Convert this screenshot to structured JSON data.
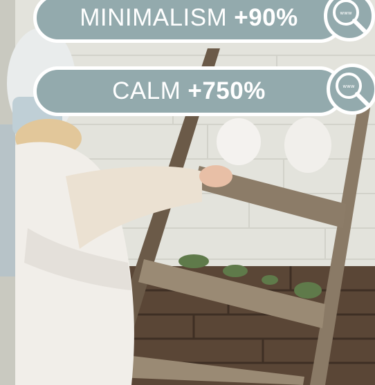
{
  "tags": [
    {
      "word": "MINIMALISM",
      "pct": "+90%"
    },
    {
      "word": "CALM",
      "pct": "+750%"
    }
  ],
  "search_icon_text": "www",
  "colors": {
    "pill": "#93aaad",
    "border": "#ffffff",
    "text": "#ffffff"
  },
  "icons": [
    "search-www-icon"
  ]
}
